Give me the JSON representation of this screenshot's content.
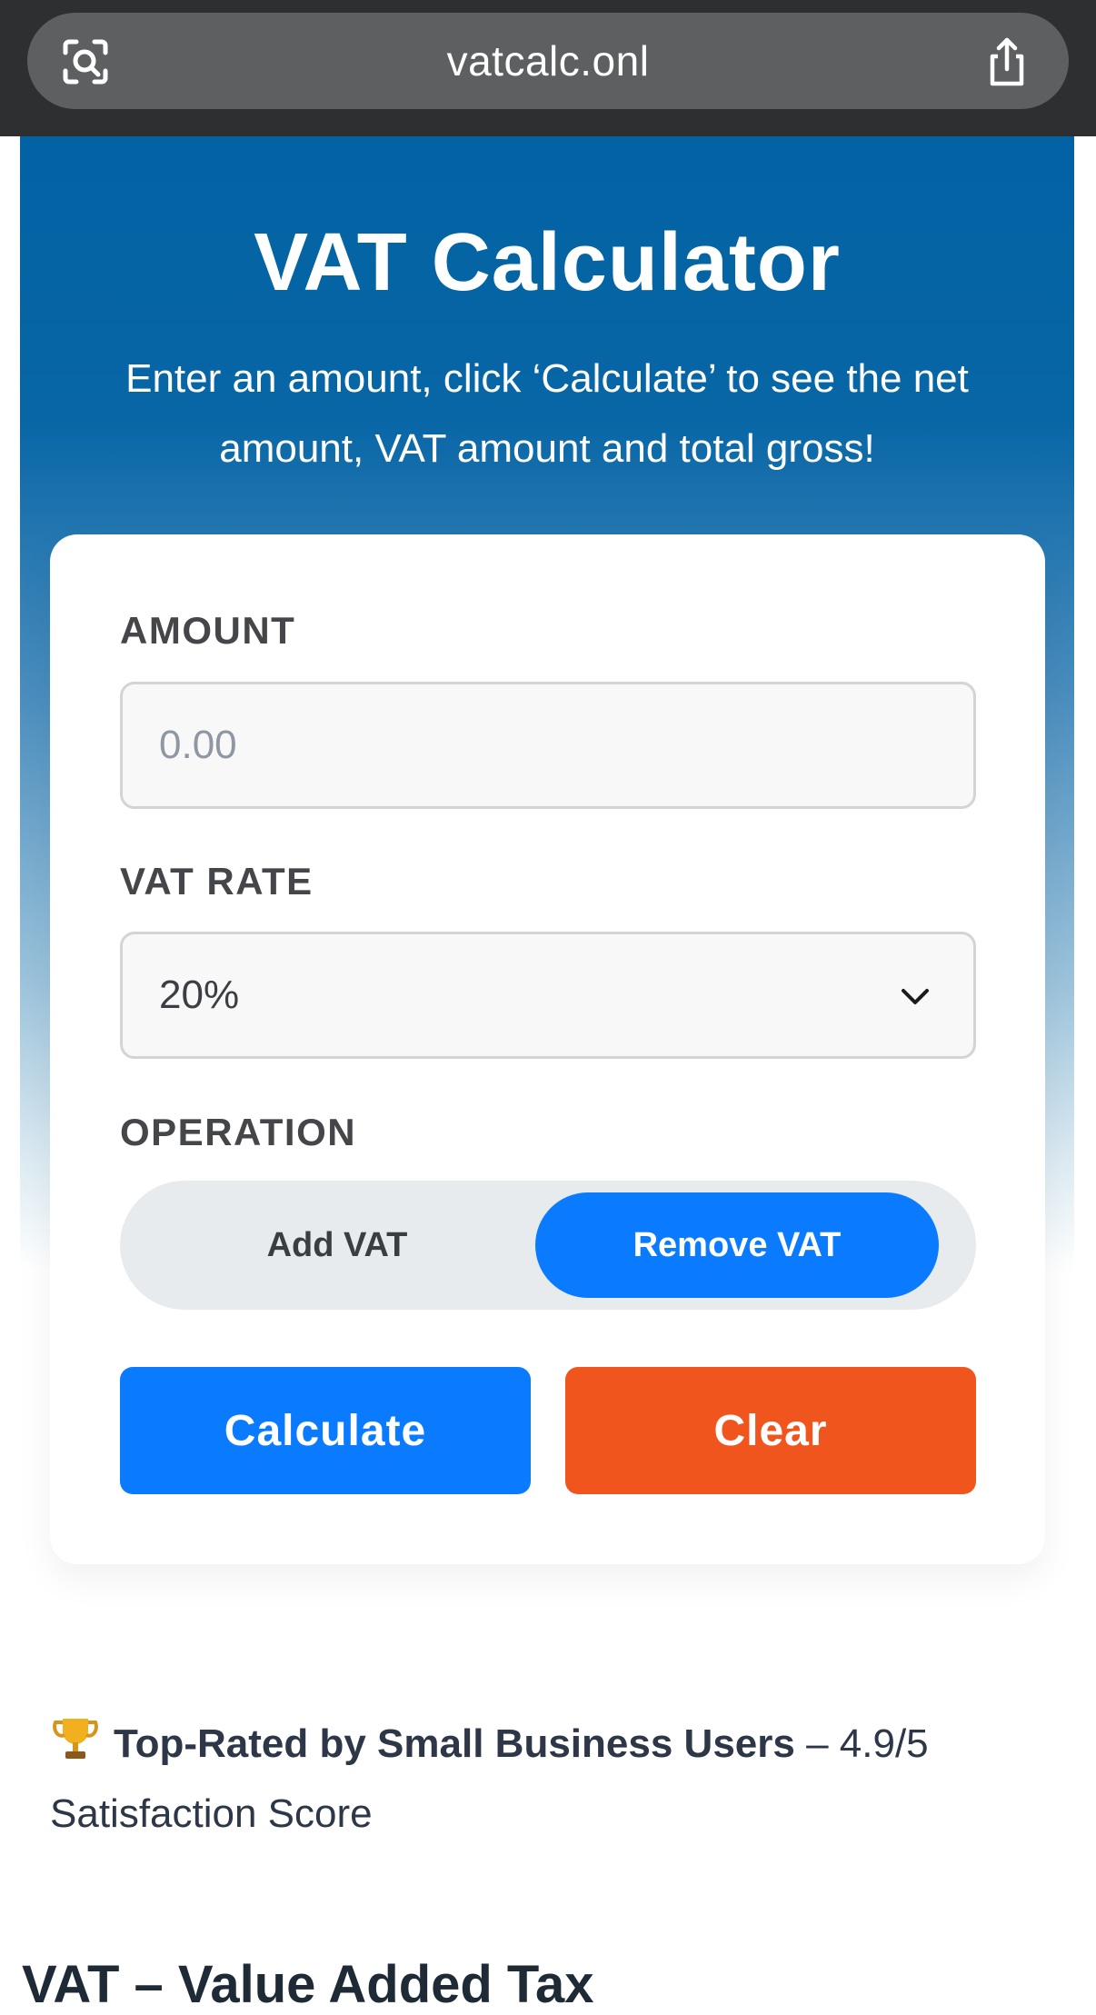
{
  "browser": {
    "url": "vatcalc.onl",
    "left_icon": "lens-scan-icon",
    "right_icon": "share-icon"
  },
  "hero": {
    "title": "VAT Calculator",
    "subtitle": "Enter an amount, click ‘Calculate’ to see the net amount, VAT amount and total gross!"
  },
  "form": {
    "amount_label": "AMOUNT",
    "amount_placeholder": "0.00",
    "amount_value": "",
    "rate_label": "VAT RATE",
    "rate_selected": "20%",
    "operation_label": "OPERATION",
    "operation_options": [
      "Add VAT",
      "Remove VAT"
    ],
    "operation_selected": "Remove VAT",
    "calculate_label": "Calculate",
    "clear_label": "Clear"
  },
  "rating": {
    "icon": "trophy-icon",
    "bold_text": "Top-Rated by Small Business Users",
    "rest_text": " – 4.9/5 Satisfaction Score"
  },
  "section": {
    "title": "VAT – Value Added Tax"
  },
  "colors": {
    "primary_blue": "#0a7bff",
    "clear_orange": "#f0551e",
    "hero_blue": "#0262a3"
  }
}
